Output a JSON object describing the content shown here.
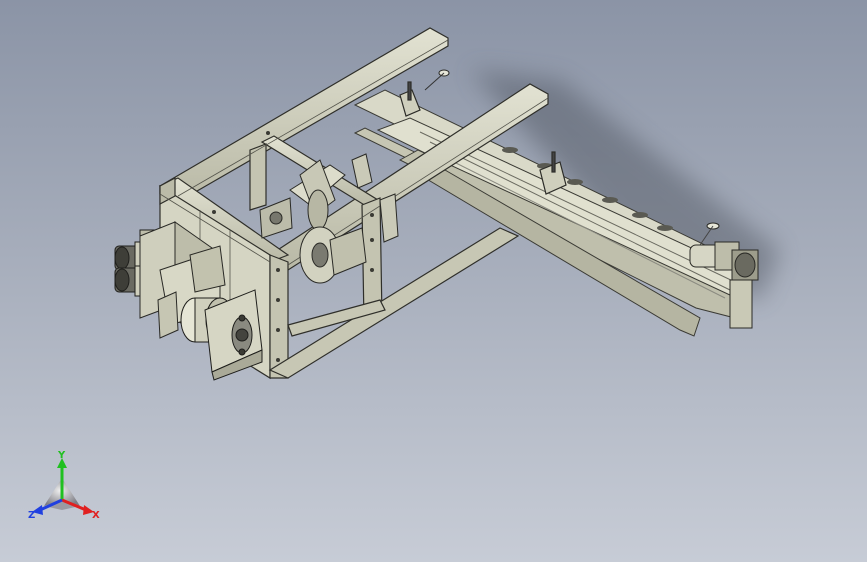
{
  "viewport": {
    "background_top": "#8b94a6",
    "background_bottom": "#c7ccd6",
    "model_fill": "#cfcfbd",
    "model_edge": "#3a3a34"
  },
  "triad": {
    "x_label": "X",
    "y_label": "Y",
    "z_label": "Z",
    "x_color": "#e02020",
    "y_color": "#20c020",
    "z_color": "#2040e0"
  }
}
